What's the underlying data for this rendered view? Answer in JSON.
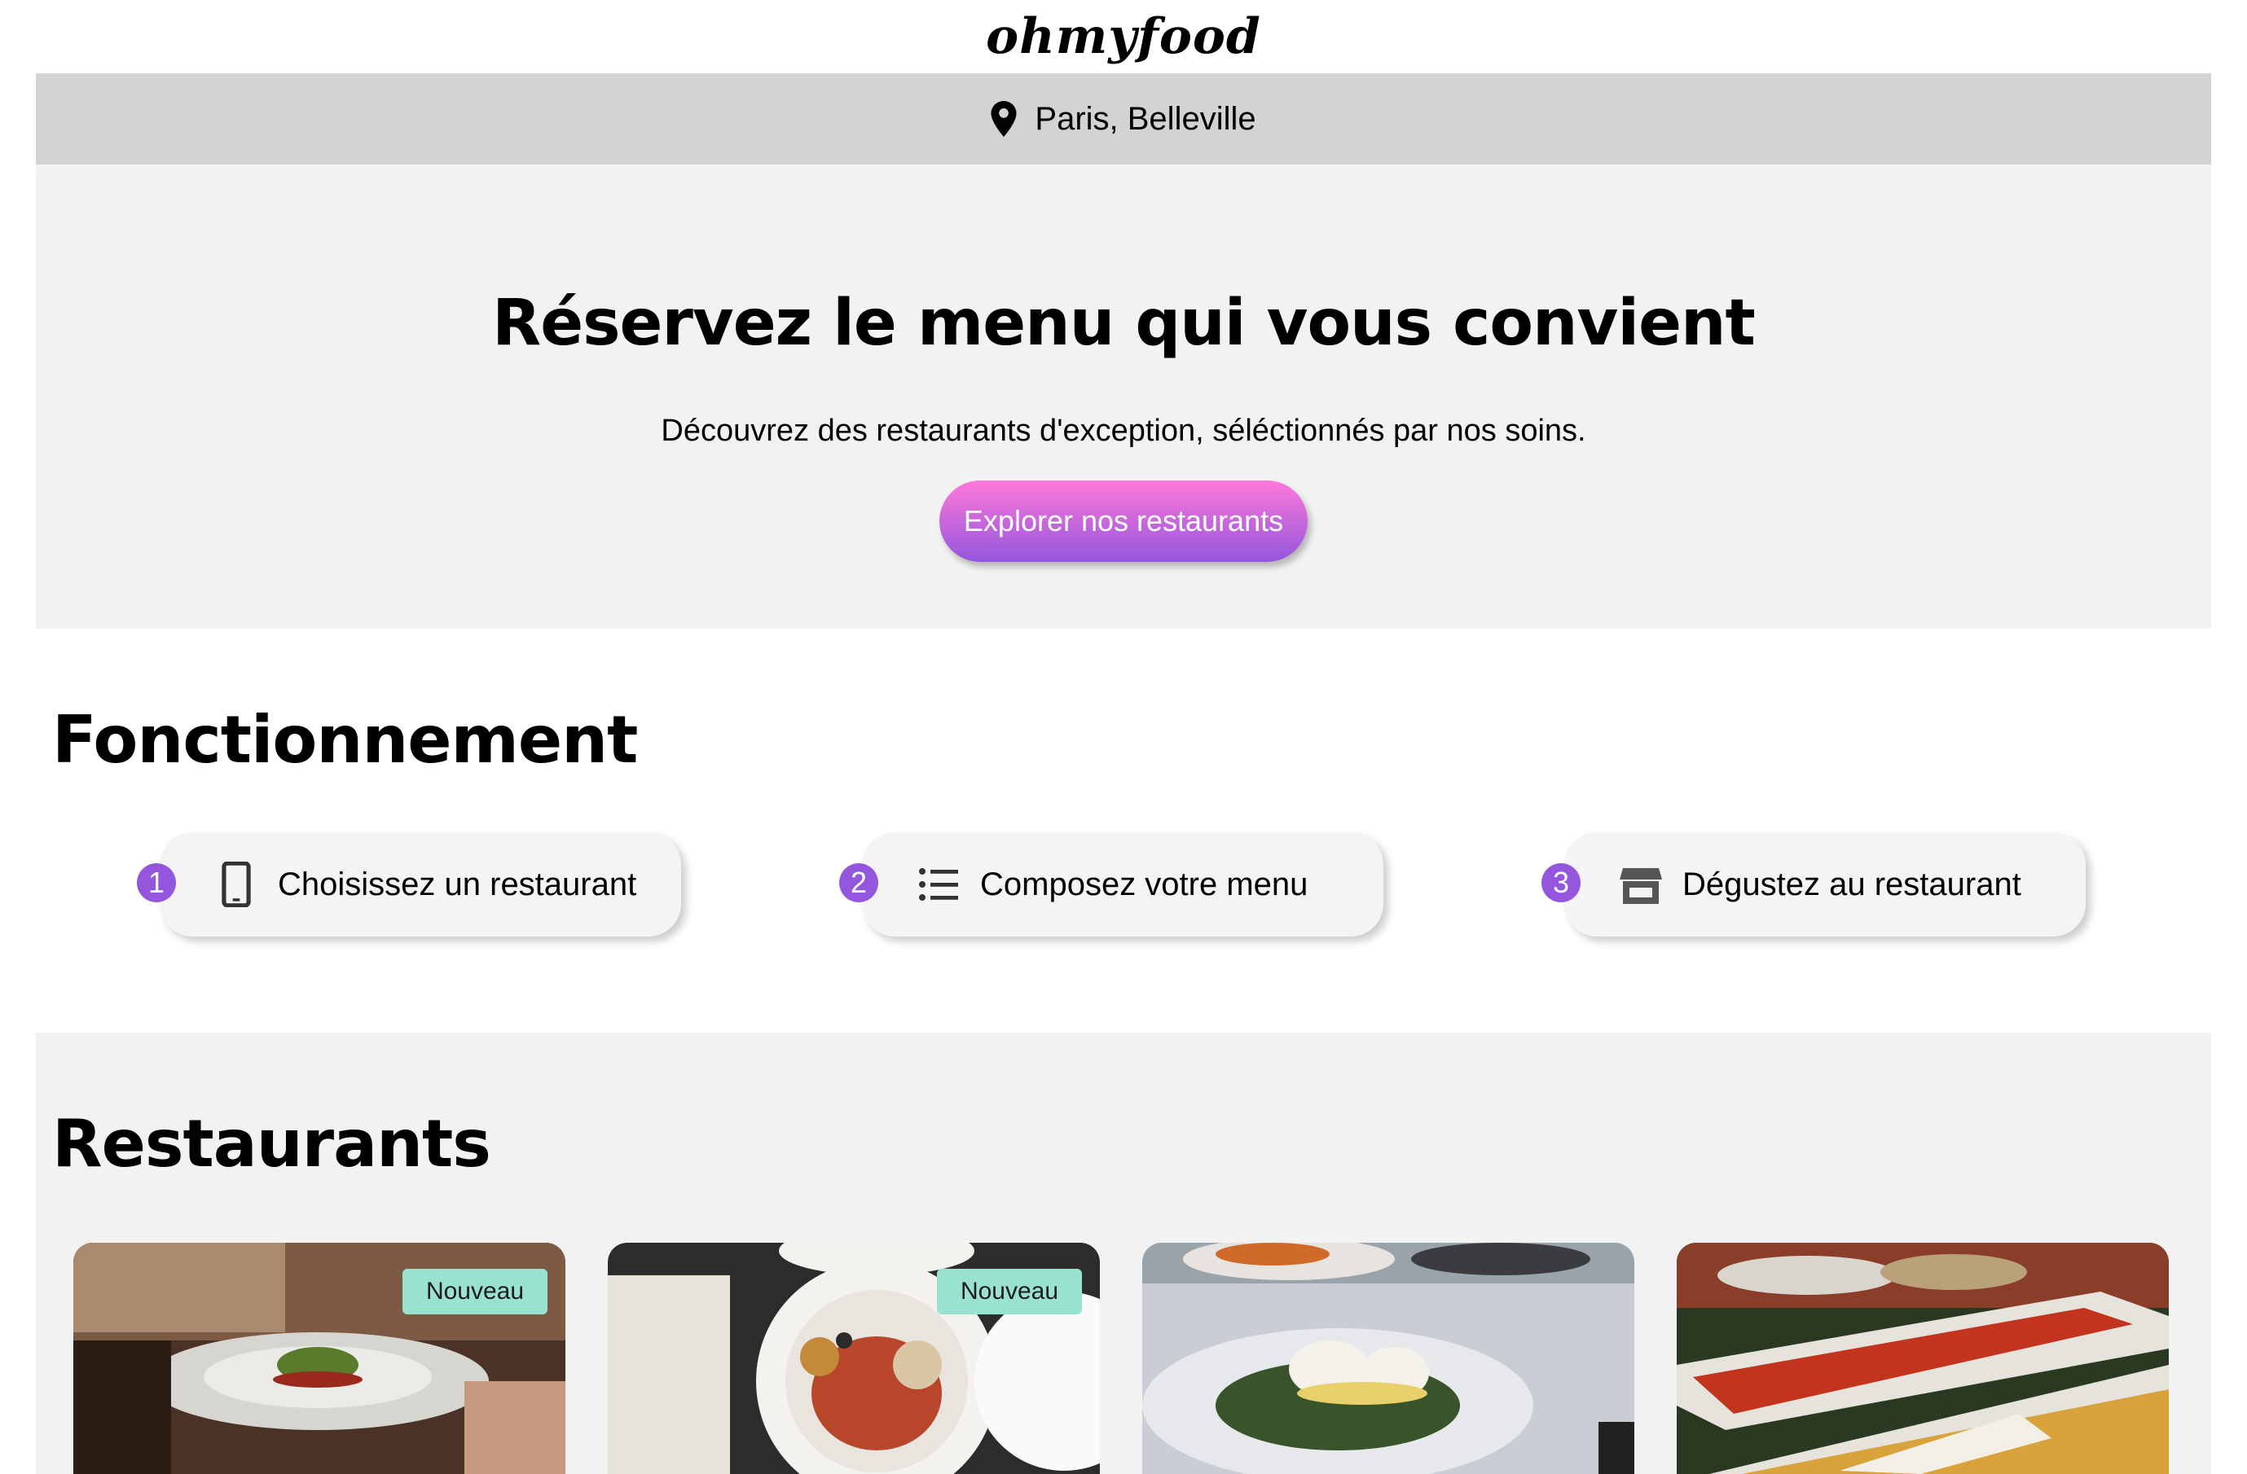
{
  "header": {
    "logo": "ohmyfood"
  },
  "location": {
    "icon": "location-pin-icon",
    "label": "Paris, Belleville"
  },
  "hero": {
    "title": "Réservez le menu qui vous convient",
    "subtitle": "Découvrez des restaurants d'exception, séléctionnés par nos soins.",
    "button_label": "Explorer nos restaurants",
    "button_gradient": [
      "#ff79da",
      "#9356dc"
    ]
  },
  "how_it_works": {
    "title": "Fonctionnement",
    "steps": [
      {
        "number": "1",
        "icon": "smartphone-icon",
        "label": "Choisissez un restaurant"
      },
      {
        "number": "2",
        "icon": "list-icon",
        "label": "Composez votre menu"
      },
      {
        "number": "3",
        "icon": "storefront-icon",
        "label": "Dégustez au restaurant"
      }
    ]
  },
  "restaurants": {
    "title": "Restaurants",
    "cards": [
      {
        "badge": "Nouveau",
        "image": "plated-dish-restaurant-photo"
      },
      {
        "badge": "Nouveau",
        "image": "mediterranean-plate-photo"
      },
      {
        "image": "poached-egg-dish-photo"
      },
      {
        "image": "seafood-platter-photo"
      }
    ]
  },
  "colors": {
    "accent": "#9356dc",
    "pink": "#ff79da",
    "badge": "#99e2d0",
    "location_bar": "#d3d3d3",
    "section_bg": "#f2f2f2"
  }
}
